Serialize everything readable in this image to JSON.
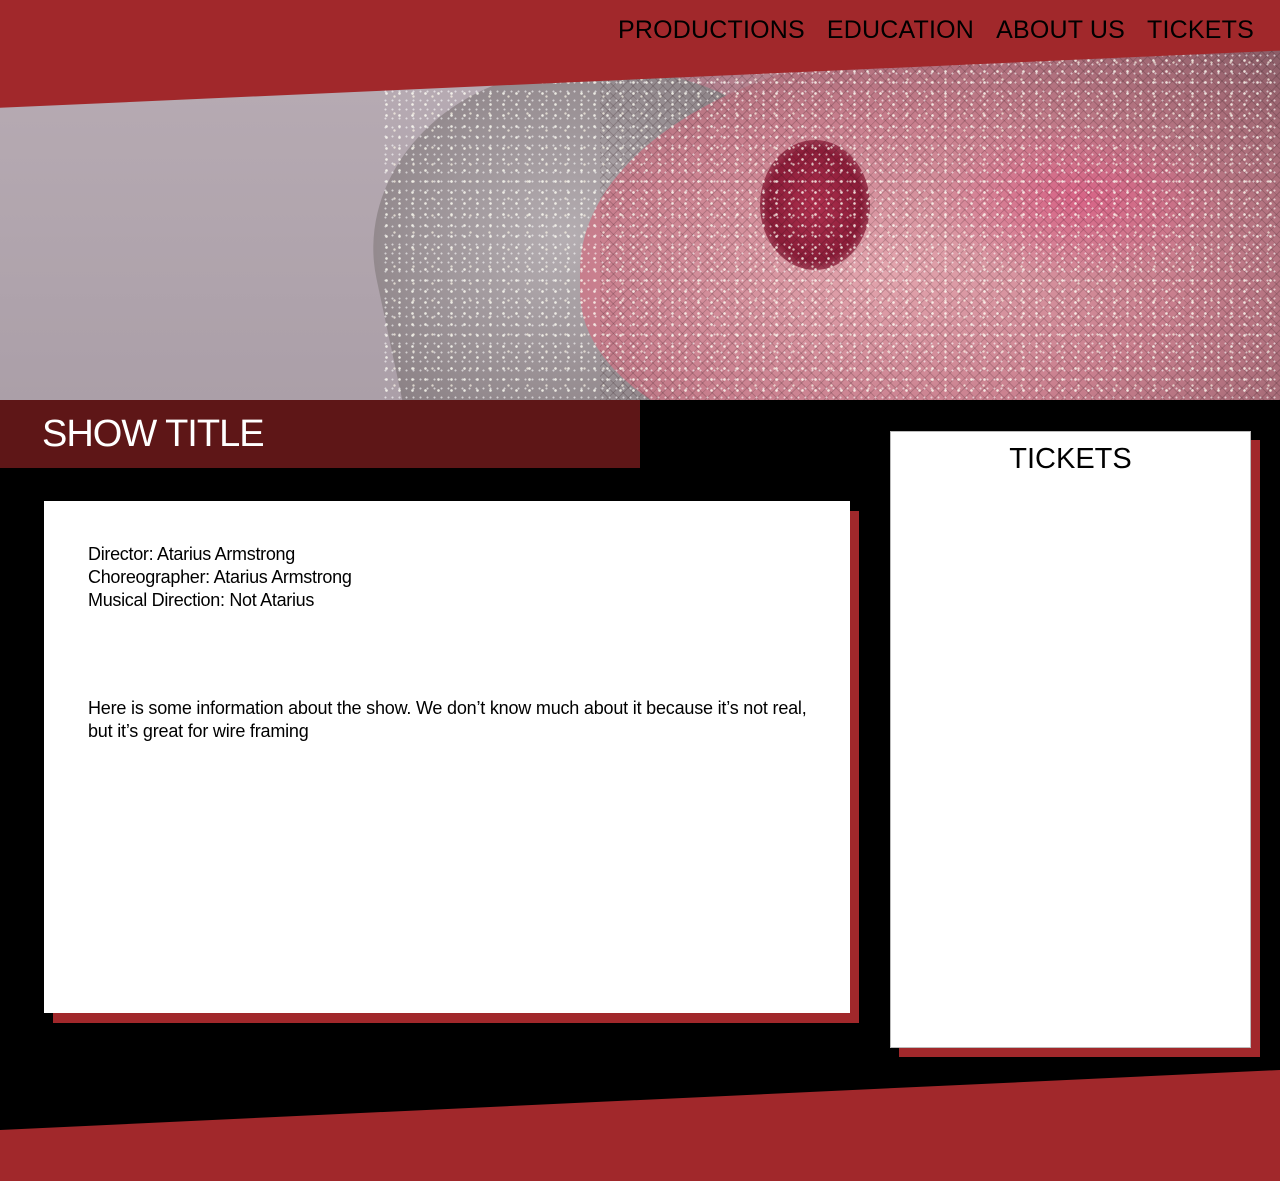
{
  "nav": {
    "items": [
      {
        "label": "PRODUCTIONS"
      },
      {
        "label": "EDUCATION"
      },
      {
        "label": "ABOUT US"
      },
      {
        "label": "TICKETS"
      }
    ]
  },
  "show": {
    "title": "SHOW TITLE",
    "credits": [
      {
        "text": "Director: Atarius Armstrong"
      },
      {
        "text": "Choreographer: Atarius Armstrong"
      },
      {
        "text": "Musical Direction: Not Atarius"
      }
    ],
    "description": "Here is some information about the show. We don’t know much about it because it’s not real, but it’s great for wire framing"
  },
  "tickets": {
    "heading": "TICKETS"
  },
  "colors": {
    "brand_red": "#a1282b",
    "title_bar": "#5e1617",
    "background": "#000000",
    "card": "#ffffff"
  }
}
